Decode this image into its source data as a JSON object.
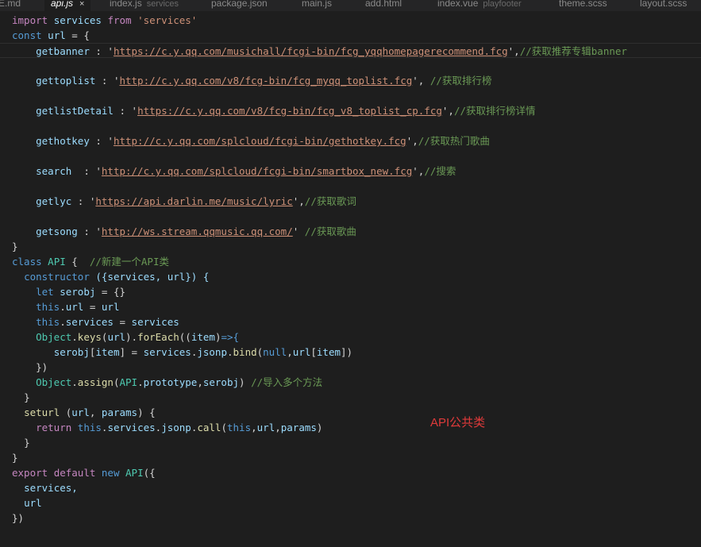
{
  "tabs": [
    {
      "label": "E.md",
      "sub": ""
    },
    {
      "label": "api.js",
      "sub": "",
      "active": true
    },
    {
      "label": "index.js",
      "sub": "services"
    },
    {
      "label": "package.json",
      "sub": ""
    },
    {
      "label": "main.js",
      "sub": ""
    },
    {
      "label": "add.html",
      "sub": ""
    },
    {
      "label": "index.vue",
      "sub": "playfooter"
    },
    {
      "label": "theme.scss",
      "sub": ""
    },
    {
      "label": "layout.scss",
      "sub": ""
    }
  ],
  "close_glyph": "×",
  "code": {
    "import_kw": "import",
    "services": "services",
    "from_kw": "from",
    "services_str": "'services'",
    "const_kw": "const",
    "url": "url",
    "eq_open": " = {",
    "entries": [
      {
        "key": "getbanner",
        "sep": " : '",
        "url": "https://c.y.qq.com/musichall/fcgi-bin/fcg_yqqhomepagerecommend.fcg",
        "end": "',",
        "comment": "//获取推荐专辑banner"
      },
      {
        "key": "gettoplist",
        "sep": " : '",
        "url": "http://c.y.qq.com/v8/fcg-bin/fcg_myqq_toplist.fcg",
        "end": "', ",
        "comment": "//获取排行榜"
      },
      {
        "key": "getlistDetail",
        "sep": " : '",
        "url": "https://c.y.qq.com/v8/fcg-bin/fcg_v8_toplist_cp.fcg",
        "end": "',",
        "comment": "//获取排行榜详情"
      },
      {
        "key": "gethotkey",
        "sep": " : '",
        "url": "http://c.y.qq.com/splcloud/fcgi-bin/gethotkey.fcg",
        "end": "',",
        "comment": "//获取热门歌曲"
      },
      {
        "key": "search",
        "sep": "  : '",
        "url": "http://c.y.qq.com/splcloud/fcgi-bin/smartbox_new.fcg",
        "end": "',",
        "comment": "//搜索"
      },
      {
        "key": "getlyc",
        "sep": " : '",
        "url": "https://api.darlin.me/music/lyric",
        "end": "',",
        "comment": "//获取歌词"
      },
      {
        "key": "getsong",
        "sep": " : '",
        "url": "http://ws.stream.qqmusic.qq.com/",
        "end": "' ",
        "comment": "//获取歌曲"
      }
    ],
    "close_brace": "}",
    "class_kw": "class",
    "api": "API",
    "class_open": " {  ",
    "class_comment": "//新建一个API类",
    "constructor": "constructor",
    "ctor_args": " ({services, url}) {",
    "let_kw": "let",
    "serobj": "serobj",
    "empty_obj": " = {}",
    "this_kw": "this",
    "object": "Object",
    "keys": "keys",
    "forEach": "forEach",
    "item": "item",
    "arrow": "=>{",
    "jsonp": "jsonp",
    "bind": "bind",
    "null_kw": "null",
    "close_paren": "})",
    "assign": "assign",
    "prototype": "prototype",
    "assign_comment": "//导入多个方法",
    "seturl": "seturl",
    "params": "params",
    "return_kw": "return",
    "call": "call",
    "export_kw": "export",
    "default_kw": "default",
    "new_kw": "new",
    "services_comma": "services,",
    "end": "})"
  },
  "annotation": "API公共类"
}
